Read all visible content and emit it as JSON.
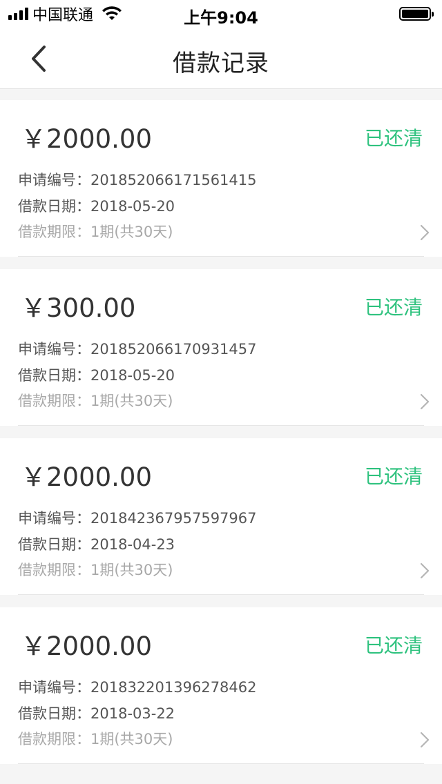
{
  "status_bar": {
    "carrier": "中国联通",
    "time": "上午9:04"
  },
  "header": {
    "title": "借款记录"
  },
  "records": [
    {
      "amount": "￥2000.00",
      "status": "已还清",
      "application_no_label": "申请编号：",
      "application_no": "201852066171561415",
      "date_label": "借款日期：",
      "date": "2018-05-20",
      "term_label": "借款期限：",
      "term": "1期(共30天)"
    },
    {
      "amount": "￥300.00",
      "status": "已还清",
      "application_no_label": "申请编号：",
      "application_no": "201852066170931457",
      "date_label": "借款日期：",
      "date": "2018-05-20",
      "term_label": "借款期限：",
      "term": "1期(共30天)"
    },
    {
      "amount": "￥2000.00",
      "status": "已还清",
      "application_no_label": "申请编号：",
      "application_no": "201842367957597967",
      "date_label": "借款日期：",
      "date": "2018-04-23",
      "term_label": "借款期限：",
      "term": "1期(共30天)"
    },
    {
      "amount": "￥2000.00",
      "status": "已还清",
      "application_no_label": "申请编号：",
      "application_no": "201832201396278462",
      "date_label": "借款日期：",
      "date": "2018-03-22",
      "term_label": "借款期限：",
      "term": "1期(共30天)"
    }
  ],
  "colors": {
    "status_green": "#2ec27e",
    "background": "#f5f5f5"
  },
  "icons": {
    "back": "chevron-left-icon",
    "row_arrow": "chevron-right-icon",
    "signal": "cellular-signal-icon",
    "wifi": "wifi-icon",
    "battery": "battery-icon"
  }
}
